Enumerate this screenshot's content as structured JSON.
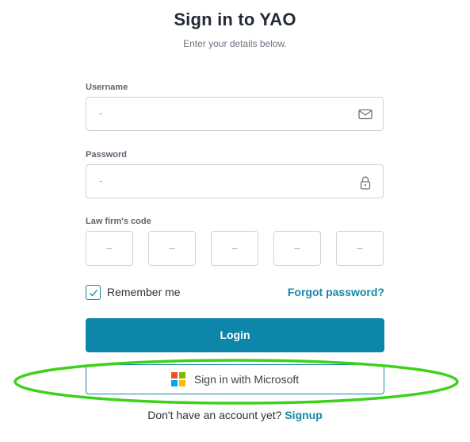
{
  "header": {
    "title": "Sign in to YAO",
    "subtitle": "Enter your details below."
  },
  "form": {
    "username": {
      "label": "Username",
      "placeholder": "-",
      "icon": "mail-icon"
    },
    "password": {
      "label": "Password",
      "placeholder": "-",
      "icon": "lock-icon"
    },
    "firm_code": {
      "label": "Law firm's code",
      "boxes": [
        "–",
        "–",
        "–",
        "–",
        "–"
      ]
    },
    "remember": {
      "label": "Remember me",
      "checked": true
    },
    "forgot_label": "Forgot password?",
    "login_label": "Login",
    "microsoft_label": "Sign in with Microsoft"
  },
  "footer": {
    "prompt": "Don't have an account yet?",
    "signup_label": "Signup"
  },
  "colors": {
    "accent": "#0e86a9",
    "link": "#1387a8",
    "highlight": "#3dd21a",
    "ms_red": "#f25022",
    "ms_green": "#7fba00",
    "ms_blue": "#00a4ef",
    "ms_yellow": "#ffb900"
  }
}
